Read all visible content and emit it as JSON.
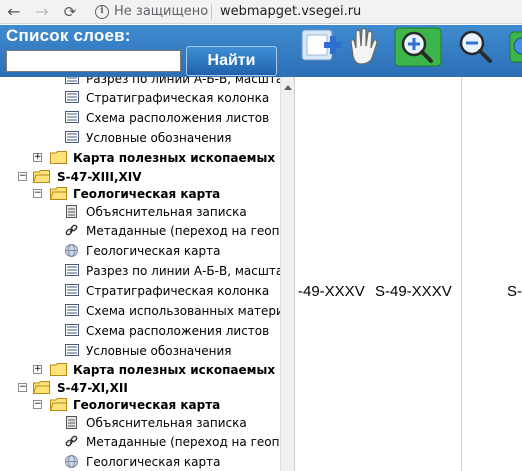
{
  "browser": {
    "security_text": "Не защищено",
    "url": "webmapget.vsegei.ru"
  },
  "toolbar": {
    "layers_title": "Список слоев:",
    "search_placeholder": "",
    "find_label": "Найти",
    "tools": [
      "add-layer-icon",
      "hand-pan-icon",
      "zoom-in-icon",
      "zoom-out-icon",
      "globe-icon"
    ]
  },
  "tree": {
    "items": [
      {
        "label": "Разрез по линии А-Б-В, масштаб",
        "icon": "legend-icon",
        "bold": false
      },
      {
        "label": "Стратиграфическая колонка",
        "icon": "legend-icon",
        "bold": false
      },
      {
        "label": "Схема расположения листов",
        "icon": "legend-icon",
        "bold": false
      },
      {
        "label": "Условные обозначения",
        "icon": "legend-icon",
        "bold": false
      },
      {
        "label": "Карта полезных ископаемых",
        "icon": "folder-icon",
        "bold": true
      },
      {
        "label": "S-47-XIII,XIV",
        "icon": "folder-icon",
        "bold": true
      },
      {
        "label": "Геологическая карта",
        "icon": "folder-icon",
        "bold": true
      },
      {
        "label": "Объяснительная записка",
        "icon": "document-icon",
        "bold": false
      },
      {
        "label": "Метаданные (переход на геопо",
        "icon": "link-icon",
        "bold": false
      },
      {
        "label": "Геологическая карта",
        "icon": "globe-icon",
        "bold": false
      },
      {
        "label": "Разрез по линии А-Б-В, масшта",
        "icon": "legend-icon",
        "bold": false
      },
      {
        "label": "Стратиграфическая колонка",
        "icon": "legend-icon",
        "bold": false
      },
      {
        "label": "Схема использованных матери",
        "icon": "legend-icon",
        "bold": false
      },
      {
        "label": "Схема расположения листов",
        "icon": "legend-icon",
        "bold": false
      },
      {
        "label": "Условные обозначения",
        "icon": "legend-icon",
        "bold": false
      },
      {
        "label": "Карта полезных ископаемых",
        "icon": "folder-icon",
        "bold": true
      },
      {
        "label": "S-47-XI,XII",
        "icon": "folder-icon",
        "bold": true
      },
      {
        "label": "Геологическая карта",
        "icon": "folder-icon",
        "bold": true
      },
      {
        "label": "Объяснительная записка",
        "icon": "document-icon",
        "bold": false
      },
      {
        "label": "Метаданные (переход на геопо",
        "icon": "link-icon",
        "bold": false
      },
      {
        "label": "Геологическая карта",
        "icon": "globe-icon",
        "bold": false
      }
    ]
  },
  "map": {
    "labels": [
      "-49-XXXV",
      "S-49-XXXV",
      "S-"
    ]
  }
}
